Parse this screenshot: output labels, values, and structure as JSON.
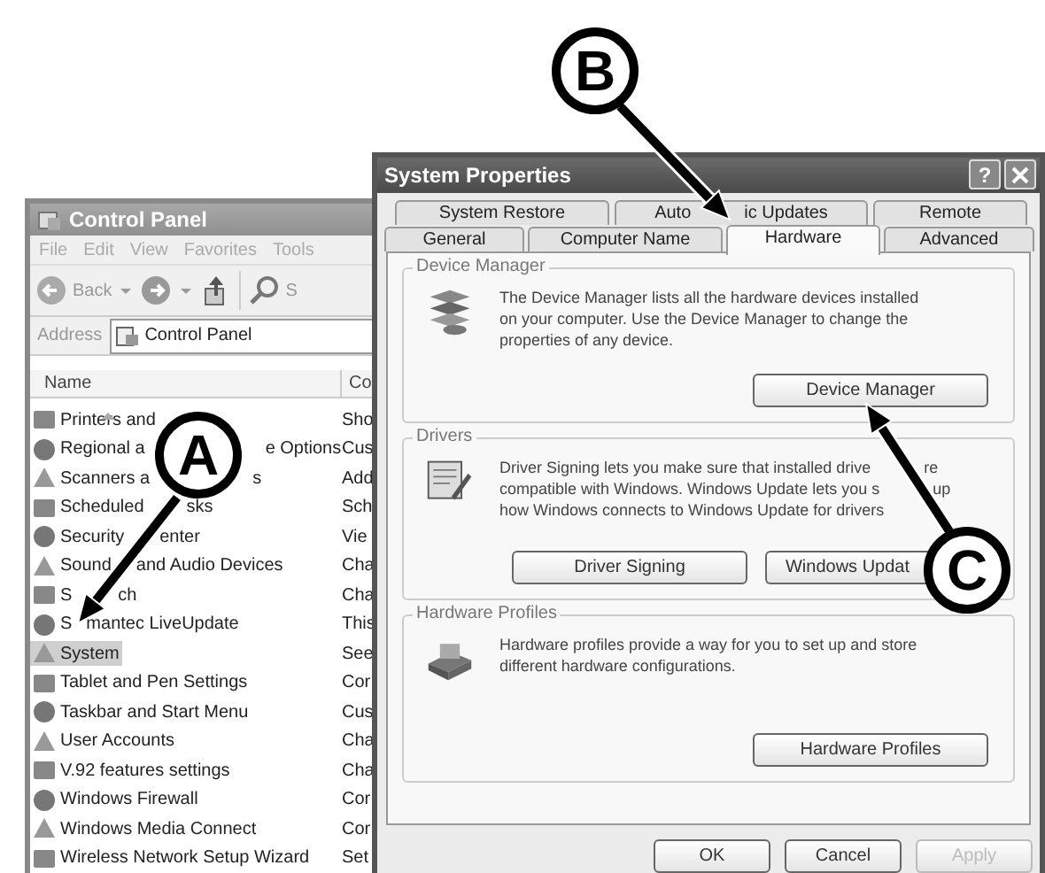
{
  "control_panel": {
    "title": "Control Panel",
    "menu": [
      "File",
      "Edit",
      "View",
      "Favorites",
      "Tools"
    ],
    "toolbar": {
      "back": "Back",
      "search": "S"
    },
    "address_label": "Address",
    "address": "Control Panel",
    "columns": [
      "Name",
      "Co"
    ],
    "items": [
      {
        "name": "Printers and",
        "column_2": "Sho",
        "selected": false
      },
      {
        "name": "Regional a",
        "tail": "e Options",
        "column_2": "Cus",
        "selected": false
      },
      {
        "name": "Scanners a",
        "tail": "s",
        "column_2": "Add",
        "selected": false
      },
      {
        "name": "Scheduled",
        "tail": "sks",
        "column_2": "Sch",
        "selected": false
      },
      {
        "name": "Security",
        "tail": "enter",
        "column_2": "Vie",
        "selected": false
      },
      {
        "name": "Sound",
        "tail": "and Audio Devices",
        "column_2": "Cha",
        "selected": false
      },
      {
        "name": "S",
        "tail": "ch",
        "column_2": "Cha",
        "selected": false
      },
      {
        "name": "S",
        "tail": "mantec LiveUpdate",
        "column_2": "This",
        "selected": false
      },
      {
        "name": "System",
        "column_2": "See",
        "selected": true
      },
      {
        "name": "Tablet and Pen Settings",
        "column_2": "Cor",
        "selected": false
      },
      {
        "name": "Taskbar and Start Menu",
        "column_2": "Cus",
        "selected": false
      },
      {
        "name": "User Accounts",
        "column_2": "Cha",
        "selected": false
      },
      {
        "name": "V.92 features settings",
        "column_2": "Cha",
        "selected": false
      },
      {
        "name": "Windows Firewall",
        "column_2": "Cor",
        "selected": false
      },
      {
        "name": "Windows Media Connect",
        "column_2": "Cor",
        "selected": false
      },
      {
        "name": "Wireless Network Setup Wizard",
        "column_2": "Set",
        "selected": false
      }
    ]
  },
  "dialog": {
    "title": "System Properties",
    "help": "?",
    "tab_rows": [
      [
        {
          "label": "System Restore",
          "selected": false
        },
        {
          "label": "Auto",
          "tail": "ic Updates",
          "selected": false
        },
        {
          "label": "Remote",
          "selected": false
        }
      ],
      [
        {
          "label": "General",
          "selected": false
        },
        {
          "label": "Computer Name",
          "selected": false
        },
        {
          "label": "Hardware",
          "selected": true
        },
        {
          "label": "Advanced",
          "selected": false
        }
      ]
    ],
    "groups": [
      {
        "title": "Device Manager",
        "kind": "device",
        "lines": [
          {
            "text": "The Device Manager lists all the hardware devices installed"
          },
          {
            "text": "on your computer. Use the Device Manager to change the"
          },
          {
            "text": "properties of any device."
          }
        ],
        "buttons": [
          "Device Manager"
        ]
      },
      {
        "title": "Drivers",
        "kind": "drivers",
        "lines": [
          {
            "text": "Driver Signing lets you make sure that installed drive",
            "tail": "re"
          },
          {
            "text": "compatible with Windows. Windows Update lets you s",
            "tail": "up"
          },
          {
            "text": "how Windows connects to Windows Update for drivers"
          }
        ],
        "buttons": [
          "Driver Signing",
          "Windows Updat"
        ]
      },
      {
        "title": "Hardware Profiles",
        "kind": "profiles",
        "lines": [
          {
            "text": "Hardware profiles provide a way for you to set up and store"
          },
          {
            "text": "different hardware configurations."
          }
        ],
        "buttons": [
          "Hardware Profiles"
        ]
      }
    ],
    "buttons": [
      {
        "label": "OK",
        "disabled": false
      },
      {
        "label": "Cancel",
        "disabled": false
      },
      {
        "label": "Apply",
        "disabled": true
      }
    ]
  },
  "callouts": [
    {
      "letter": "A"
    },
    {
      "letter": "B"
    },
    {
      "letter": "C"
    }
  ]
}
